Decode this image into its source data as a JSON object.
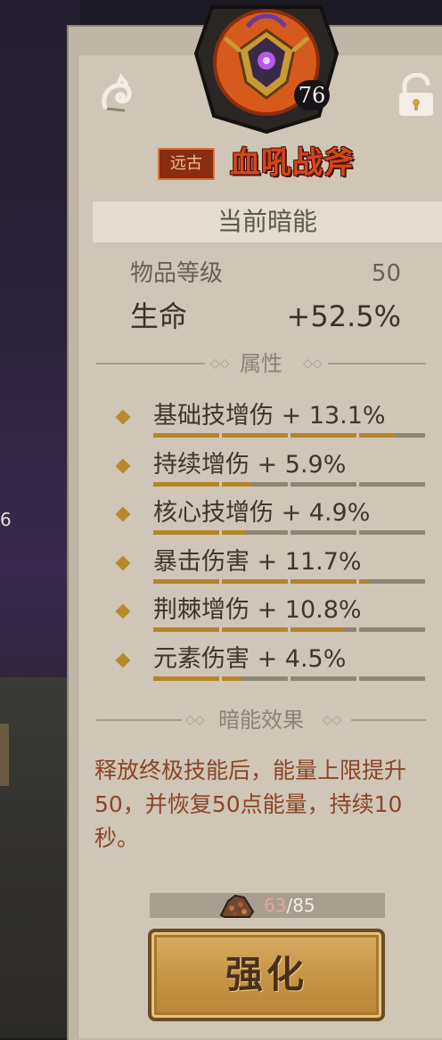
{
  "background": {
    "badge_text": "6"
  },
  "item": {
    "level": "76",
    "rarity": "远古",
    "name": "血吼战斧",
    "emblem_icon": "amulet-emblem-icon"
  },
  "current_dark_energy": {
    "title": "当前暗能",
    "item_level_label": "物品等级",
    "item_level_value": "50",
    "life_label": "生命",
    "life_value": "+52.5%"
  },
  "attributes": {
    "title": "属性",
    "items": [
      {
        "text": "基础技增伤 + 13.1%",
        "fills": [
          1,
          1,
          1,
          0.55
        ]
      },
      {
        "text": "持续增伤 + 5.9%",
        "fills": [
          1,
          0.45,
          0,
          0
        ]
      },
      {
        "text": "核心技增伤 + 4.9%",
        "fills": [
          1,
          0.35,
          0,
          0
        ]
      },
      {
        "text": "暴击伤害 + 11.7%",
        "fills": [
          1,
          1,
          1,
          0.15
        ]
      },
      {
        "text": "荆棘增伤 + 10.8%",
        "fills": [
          1,
          1,
          0.8,
          0
        ]
      },
      {
        "text": "元素伤害 + 4.5%",
        "fills": [
          1,
          0.3,
          0,
          0
        ]
      }
    ]
  },
  "effect": {
    "title": "暗能效果",
    "description": "释放终极技能后，能量上限提升50，并恢复50点能量，持续10秒。"
  },
  "cost": {
    "have": "63",
    "separator": "/",
    "need": "85",
    "icon": "ore-icon"
  },
  "button": {
    "label": "强化"
  },
  "icons": {
    "lock": "lock-icon",
    "swirl": "swirl-icon"
  },
  "colors": {
    "accent_gold": "#b5852a",
    "item_name_red": "#d4461c",
    "effect_text": "#8a4626",
    "rarity_bg": "#8a2c12"
  }
}
